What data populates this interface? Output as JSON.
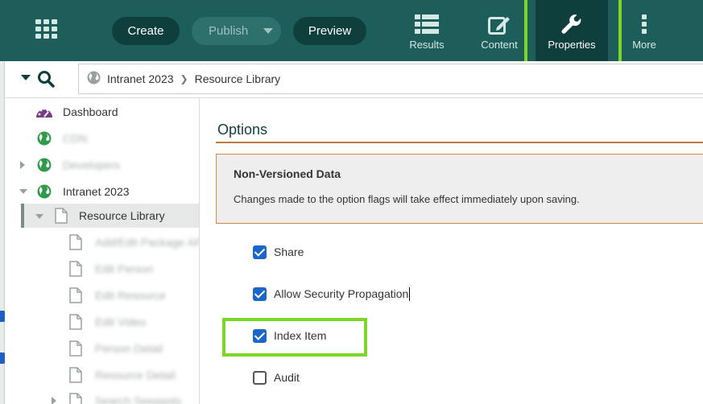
{
  "toolbar": {
    "create_label": "Create",
    "publish_label": "Publish",
    "preview_label": "Preview"
  },
  "nav": {
    "results_label": "Results",
    "content_label": "Content",
    "properties_label": "Properties",
    "more_label": "More",
    "active": "Properties"
  },
  "breadcrumb": {
    "items": [
      "Intranet 2023",
      "Resource Library"
    ]
  },
  "sidebar": {
    "items": [
      {
        "label": "Dashboard",
        "icon": "dashboard-gauge-icon",
        "icon_color": "#7b3a8c"
      },
      {
        "label": "CDN",
        "icon": "globe-icon",
        "blurred": true
      },
      {
        "label": "Developers",
        "icon": "globe-icon",
        "blurred": true
      },
      {
        "label": "Intranet 2023",
        "icon": "globe-icon"
      },
      {
        "label": "Resource Library",
        "icon": "page-icon",
        "selected": true
      },
      {
        "label": "Add/Edit Package API",
        "icon": "page-icon",
        "blurred": true
      },
      {
        "label": "Edit Person",
        "icon": "page-icon",
        "blurred": true
      },
      {
        "label": "Edit Resource",
        "icon": "page-icon",
        "blurred": true
      },
      {
        "label": "Edit Video",
        "icon": "page-icon",
        "blurred": true
      },
      {
        "label": "Person Detail",
        "icon": "page-icon",
        "blurred": true
      },
      {
        "label": "Resource Detail",
        "icon": "page-icon",
        "blurred": true
      },
      {
        "label": "Search Seeepots",
        "icon": "page-icon",
        "blurred": true
      }
    ],
    "globe_color": "#2e9a4a"
  },
  "options": {
    "title": "Options",
    "notice_title": "Non-Versioned Data",
    "notice_text": "Changes made to the option flags will take effect immediately upon saving.",
    "checkboxes": [
      {
        "label": "Share",
        "checked": true
      },
      {
        "label": "Allow Security Propagation",
        "checked": true
      },
      {
        "label": "Index Item",
        "checked": true
      },
      {
        "label": "Audit",
        "checked": false
      }
    ]
  },
  "colors": {
    "topbar": "#1d5e5b",
    "accent_dark": "#0e3f3c",
    "highlight": "#7dd626",
    "checkbox": "#1a66c9",
    "rule": "#c07a3a"
  }
}
